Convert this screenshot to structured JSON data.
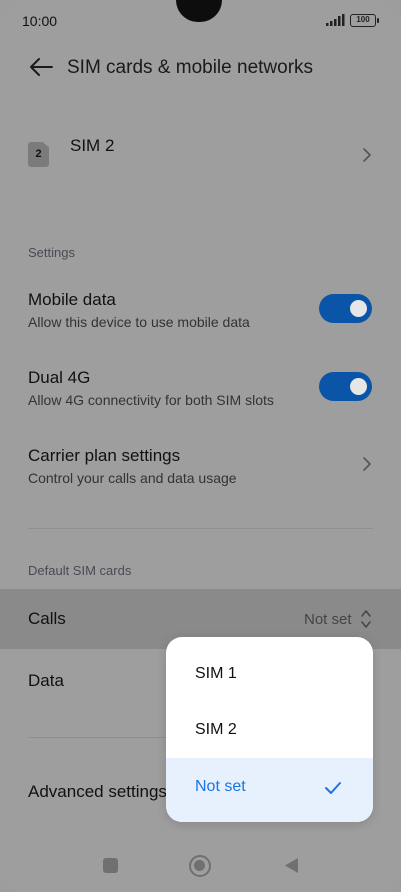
{
  "status_bar": {
    "time": "10:00",
    "battery": "100"
  },
  "header": {
    "title": "SIM cards & mobile networks"
  },
  "sim": {
    "chip_number": "2",
    "label": "SIM 2"
  },
  "settings_section": {
    "header": "Settings"
  },
  "mobile_data": {
    "title": "Mobile data",
    "subtitle": "Allow this device to use mobile data",
    "enabled": true
  },
  "dual_4g": {
    "title": "Dual 4G",
    "subtitle": "Allow 4G connectivity for both SIM slots",
    "enabled": true
  },
  "carrier_plan": {
    "title": "Carrier plan settings",
    "subtitle": "Control your calls and data usage"
  },
  "default_sim_section": {
    "header": "Default SIM cards"
  },
  "calls": {
    "label": "Calls",
    "value": "Not set"
  },
  "data_row": {
    "label": "Data"
  },
  "advanced": {
    "label": "Advanced settings"
  },
  "dropdown": {
    "options": [
      {
        "label": "SIM 1"
      },
      {
        "label": "SIM 2"
      },
      {
        "label": "Not set",
        "selected": true
      }
    ]
  },
  "colors": {
    "accent": "#0a55a8",
    "selected_text": "#1a73e8",
    "selected_bg": "#e7f1fd"
  }
}
